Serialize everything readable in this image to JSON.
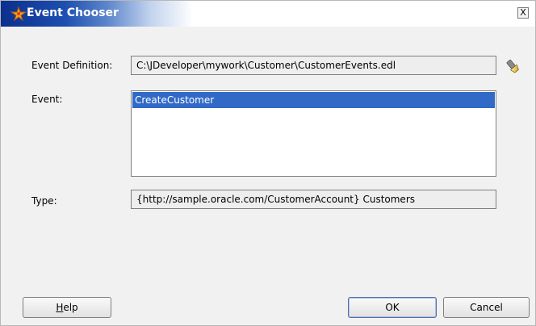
{
  "window": {
    "title": "Event Chooser",
    "close_label": "X"
  },
  "form": {
    "event_definition_label": "Event Definition:",
    "event_definition_value": "C:\\JDeveloper\\mywork\\Customer\\CustomerEvents.edl",
    "event_label": "Event:",
    "events": [
      "CreateCustomer"
    ],
    "selected_event": "CreateCustomer",
    "type_label": "Type:",
    "type_value": "{http://sample.oracle.com/CustomerAccount} Customers"
  },
  "buttons": {
    "help_first": "H",
    "help_rest": "elp",
    "ok": "OK",
    "cancel": "Cancel"
  },
  "icons": {
    "title": "jdeveloper-app-icon",
    "browse": "flashlight-icon"
  },
  "colors": {
    "titlebar_dark": "#0b2f8e",
    "selection": "#3169c6",
    "dialog_bg": "#f1f1f1"
  }
}
